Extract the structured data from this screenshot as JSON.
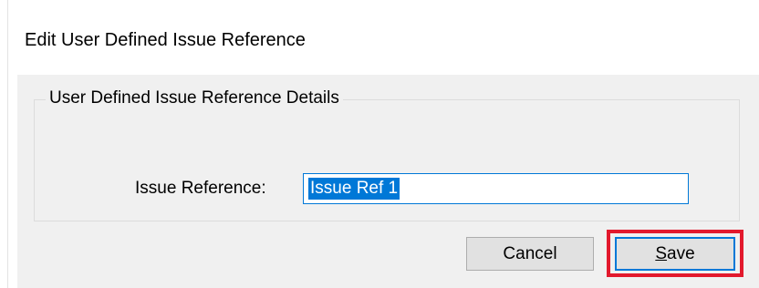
{
  "window": {
    "title": "Edit User Defined Issue Reference"
  },
  "group": {
    "legend": "User Defined Issue Reference Details"
  },
  "form": {
    "issue_reference_label": "Issue Reference:",
    "issue_reference_value": "Issue Ref 1"
  },
  "buttons": {
    "cancel_label": "Cancel",
    "save_label_mnemonic": "S",
    "save_label_rest": "ave"
  },
  "colors": {
    "highlight": "#e2192d",
    "focus_accent": "#0078d7"
  }
}
